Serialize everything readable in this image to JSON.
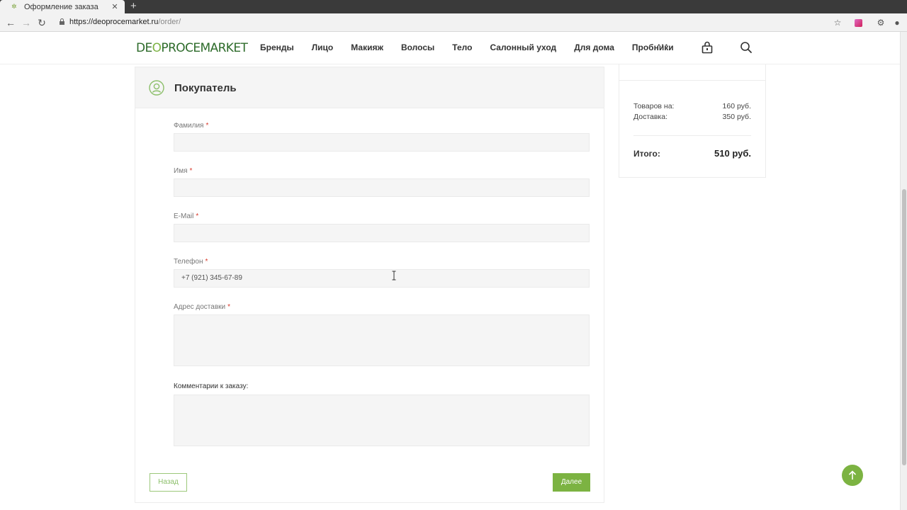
{
  "browser": {
    "tab_title": "Оформление заказа",
    "tab_close": "✕",
    "new_tab": "+",
    "url_host": "https://deoprocemarket.ru",
    "url_path": "/order/"
  },
  "header": {
    "logo_left": "DE",
    "logo_o": "O",
    "logo_right": "PROCEMARKET",
    "menu": [
      "Бренды",
      "Лицо",
      "Макияж",
      "Волосы",
      "Тело",
      "Салонный уход",
      "Для дома",
      "Пробники"
    ],
    "more": "···"
  },
  "form": {
    "title": "Покупатель",
    "fields": {
      "last_name": {
        "label": "Фамилия",
        "value": ""
      },
      "first_name": {
        "label": "Имя",
        "value": ""
      },
      "email": {
        "label": "E-Mail",
        "value": ""
      },
      "phone": {
        "label": "Телефон",
        "value": "+7 (921) 345-67-89"
      },
      "address": {
        "label": "Адрес доставки",
        "value": ""
      },
      "comment": {
        "label": "Комментарии к заказу:",
        "value": ""
      }
    },
    "required_mark": "*",
    "back_label": "Назад",
    "next_label": "Далее"
  },
  "summary": {
    "goods_label": "Товаров на:",
    "goods_value": "160 руб.",
    "delivery_label": "Доставка:",
    "delivery_value": "350 руб.",
    "total_label": "Итого:",
    "total_value": "510 руб."
  },
  "colors": {
    "accent": "#7cb342",
    "logo_dark": "#2d6b2a",
    "required": "#d8392b"
  }
}
